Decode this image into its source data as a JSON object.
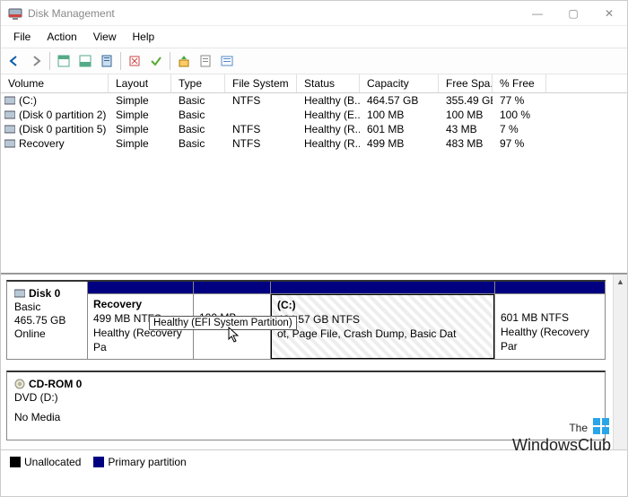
{
  "window": {
    "title": "Disk Management",
    "controls": {
      "min": "—",
      "max": "▢",
      "close": "✕"
    }
  },
  "menu": {
    "file": "File",
    "action": "Action",
    "view": "View",
    "help": "Help"
  },
  "columns": {
    "volume": "Volume",
    "layout": "Layout",
    "type": "Type",
    "fs": "File System",
    "status": "Status",
    "capacity": "Capacity",
    "free": "Free Spa...",
    "pct": "% Free"
  },
  "volumes": [
    {
      "name": "(C:)",
      "layout": "Simple",
      "type": "Basic",
      "fs": "NTFS",
      "status": "Healthy (B...",
      "capacity": "464.57 GB",
      "free": "355.49 GB",
      "pct": "77 %"
    },
    {
      "name": "(Disk 0 partition 2)",
      "layout": "Simple",
      "type": "Basic",
      "fs": "",
      "status": "Healthy (E...",
      "capacity": "100 MB",
      "free": "100 MB",
      "pct": "100 %"
    },
    {
      "name": "(Disk 0 partition 5)",
      "layout": "Simple",
      "type": "Basic",
      "fs": "NTFS",
      "status": "Healthy (R...",
      "capacity": "601 MB",
      "free": "43 MB",
      "pct": "7 %"
    },
    {
      "name": "Recovery",
      "layout": "Simple",
      "type": "Basic",
      "fs": "NTFS",
      "status": "Healthy (R...",
      "capacity": "499 MB",
      "free": "483 MB",
      "pct": "97 %"
    }
  ],
  "disk0": {
    "name": "Disk 0",
    "type": "Basic",
    "size": "465.75 GB",
    "state": "Online",
    "parts": [
      {
        "title": "Recovery",
        "line2": "499 MB NTFS",
        "line3": "Healthy (Recovery Pa"
      },
      {
        "title": "",
        "line2": "100 MB",
        "line3": ""
      },
      {
        "title": "(C:)",
        "line2": "464.57 GB NTFS",
        "line3": "ot, Page File, Crash Dump, Basic Dat"
      },
      {
        "title": "",
        "line2": "601 MB NTFS",
        "line3": "Healthy (Recovery Par"
      }
    ],
    "tooltip": "Healthy (EFI System Partition)"
  },
  "cdrom": {
    "name": "CD-ROM 0",
    "line2": "DVD (D:)",
    "line3": "No Media"
  },
  "legend": {
    "unalloc": "Unallocated",
    "primary": "Primary partition"
  },
  "watermark": {
    "line1": "The",
    "line2": "WindowsClub"
  }
}
